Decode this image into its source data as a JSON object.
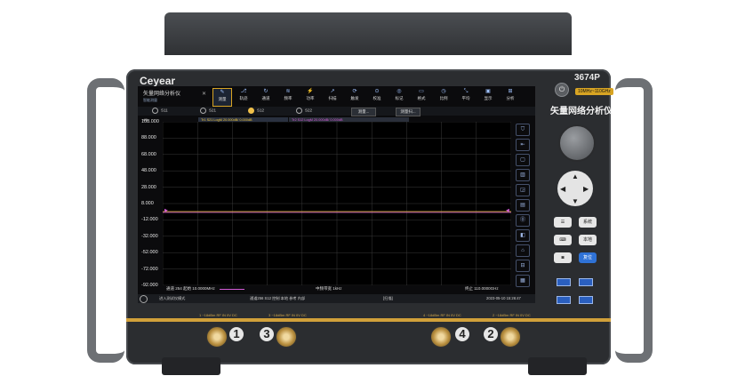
{
  "device": {
    "brand": "Ceyear",
    "model": "3674P",
    "range": "10MHz~110GHz",
    "title_cn": "矢量网络分析仪"
  },
  "window": {
    "title": "矢量网络分析仪",
    "subtitle": "智能测量"
  },
  "toolbar": [
    {
      "label": "测量",
      "icon": "✎",
      "active": true
    },
    {
      "label": "轨迹",
      "icon": "⎇"
    },
    {
      "label": "通道",
      "icon": "↻"
    },
    {
      "label": "频率",
      "icon": "≋"
    },
    {
      "label": "功率",
      "icon": "⚡"
    },
    {
      "label": "扫描",
      "icon": "↗"
    },
    {
      "label": "触发",
      "icon": "⟳"
    },
    {
      "label": "校准",
      "icon": "⊙"
    },
    {
      "label": "标记",
      "icon": "◎"
    },
    {
      "label": "格式",
      "icon": "▭"
    },
    {
      "label": "比例",
      "icon": "◷"
    },
    {
      "label": "平均",
      "icon": "⤡"
    },
    {
      "label": "显示",
      "icon": "▣"
    },
    {
      "label": "分析",
      "icon": "⊞"
    }
  ],
  "traces": [
    {
      "label": "S11",
      "selected": false
    },
    {
      "label": "S21",
      "selected": false
    },
    {
      "label": "S12",
      "selected": true
    },
    {
      "label": "S22",
      "selected": false
    }
  ],
  "trace_buttons": [
    "测量...",
    "测量扫..."
  ],
  "trace_labels": {
    "t1": "Tr1 S21 LogM 20.000dB/ 0.000dB",
    "t2": "Tr2 S12 LogM 20.000dB/ 0.000dB"
  },
  "y_axis": {
    "unit": "dB",
    "ticks": [
      "108.000",
      "88.000",
      "68.000",
      "48.000",
      "28.000",
      "8.000",
      "-12.000",
      "-32.000",
      "-52.000",
      "-72.000",
      "-92.000"
    ]
  },
  "status": {
    "left": "通道 254 起始 10.0000MHz",
    "center": "中频带宽 1kHz",
    "right": "终止 110.0000GHz"
  },
  "bottom_bar": {
    "msg": "进入测试仪模式",
    "info": "通道256 S12 控制 本地 参考 内部",
    "mode": "[扫描]",
    "time": "2023-05-10 15:26:47"
  },
  "side_icons": [
    "⛉",
    "⇤",
    "▢",
    "▥",
    "◲",
    "▤",
    "⓪",
    "◧",
    "⌂",
    "⊟",
    "▦"
  ],
  "hw_buttons": {
    "row1": [
      "☰",
      "系统"
    ],
    "row2": [
      "⌨",
      "本地"
    ],
    "row3": [
      "◙",
      "复位"
    ]
  },
  "ports": [
    {
      "num": "1",
      "label": "1 ~18dBm RF IN 0V DC"
    },
    {
      "num": "3",
      "label": "3 ~18dBm RF IN 0V DC"
    },
    {
      "num": "4",
      "label": "4 ~18dBm RF IN 0V DC"
    },
    {
      "num": "2",
      "label": "2 ~18dBm RF IN 0V DC"
    }
  ],
  "colors": {
    "trace1": "#f0c63a",
    "trace2": "#d25bd6",
    "accent": "#d8a423",
    "grid": "#3a3a3a"
  }
}
